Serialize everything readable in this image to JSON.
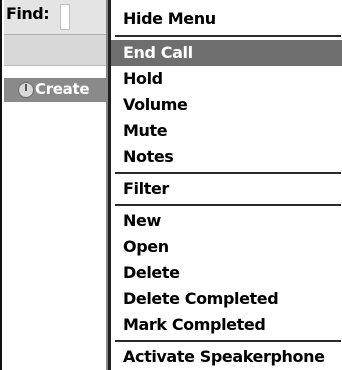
{
  "find": {
    "label": "Find:"
  },
  "list": {
    "create_label": "Create"
  },
  "menu": {
    "header": "Hide Menu",
    "group1": [
      "End Call",
      "Hold",
      "Volume",
      "Mute",
      "Notes"
    ],
    "selected": "End Call",
    "filter": "Filter",
    "group3": [
      "New",
      "Open",
      "Delete",
      "Delete Completed",
      "Mark Completed"
    ],
    "last": "Activate Speakerphone"
  }
}
